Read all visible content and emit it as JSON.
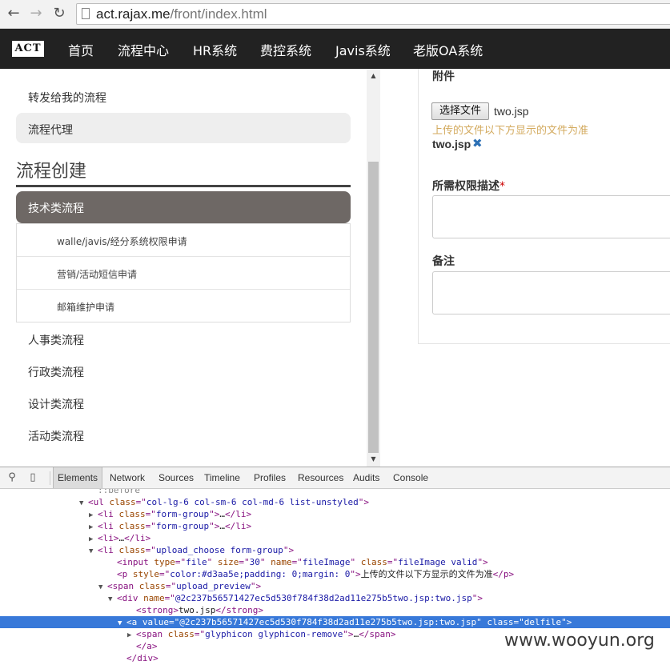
{
  "browser": {
    "back_icon": "back-arrow-icon",
    "forward_icon": "forward-arrow-icon",
    "reload_icon": "reload-icon",
    "url_host": "act.rajax.me",
    "url_path": "/front/index.html"
  },
  "app_nav": {
    "logo": "ACT",
    "items": [
      "首页",
      "流程中心",
      "HR系统",
      "费控系统",
      "Javis系统",
      "老版OA系统"
    ]
  },
  "sidebar": {
    "links_top": [
      "转发给我的流程",
      "流程代理"
    ],
    "section_title": "流程创建",
    "active_item": "技术类流程",
    "sub_items": [
      "walle/javis/经分系统权限申请",
      "营销/活动短信申请",
      "邮箱维护申请"
    ],
    "links_bottom": [
      "人事类流程",
      "行政类流程",
      "设计类流程",
      "活动类流程"
    ]
  },
  "form": {
    "attachment_label": "附件",
    "file_button": "选择文件",
    "file_name": "two.jsp",
    "upload_hint": "上传的文件以下方显示的文件为准",
    "preview_name": "two.jsp",
    "remove_icon": "remove-icon",
    "permission_label": "所需权限描述",
    "required_mark": "*",
    "remark_label": "备注",
    "hint_color": "#d3aa5e"
  },
  "devtools": {
    "search_icon": "search-icon",
    "device_icon": "mobile-device-icon",
    "tabs": [
      "Elements",
      "Network",
      "Sources",
      "Timeline",
      "Profiles",
      "Resources",
      "Audits",
      "Console"
    ],
    "active_tab": "Elements",
    "lines": [
      {
        "tri": "",
        "parts": [
          [
            "pseudo",
            "::before"
          ]
        ]
      },
      {
        "tri": "▼",
        "parts": [
          [
            "tg",
            "<ul "
          ],
          [
            "at",
            "class"
          ],
          [
            "tg",
            "=\""
          ],
          [
            "av",
            "col-lg-6 col-sm-6 col-md-6 list-unstyled"
          ],
          [
            "tg",
            "\">"
          ]
        ]
      },
      {
        "tri": "▶",
        "parts": [
          [
            "tg",
            "<li "
          ],
          [
            "at",
            "class"
          ],
          [
            "tg",
            "=\""
          ],
          [
            "av",
            "form-group"
          ],
          [
            "tg",
            "\">"
          ],
          [
            "tx",
            "…"
          ],
          [
            "tg",
            "</li>"
          ]
        ]
      },
      {
        "tri": "▶",
        "parts": [
          [
            "tg",
            "<li "
          ],
          [
            "at",
            "class"
          ],
          [
            "tg",
            "=\""
          ],
          [
            "av",
            "form-group"
          ],
          [
            "tg",
            "\">"
          ],
          [
            "tx",
            "…"
          ],
          [
            "tg",
            "</li>"
          ]
        ]
      },
      {
        "tri": "▶",
        "parts": [
          [
            "tg",
            "<li>"
          ],
          [
            "tx",
            "…"
          ],
          [
            "tg",
            "</li>"
          ]
        ]
      },
      {
        "tri": "▼",
        "parts": [
          [
            "tg",
            "<li "
          ],
          [
            "at",
            "class"
          ],
          [
            "tg",
            "=\""
          ],
          [
            "av",
            "upload_choose form-group"
          ],
          [
            "tg",
            "\">"
          ]
        ]
      },
      {
        "tri": "",
        "parts": [
          [
            "tg",
            "<input "
          ],
          [
            "at",
            "type"
          ],
          [
            "tg",
            "=\""
          ],
          [
            "av",
            "file"
          ],
          [
            "tg",
            "\" "
          ],
          [
            "at",
            "size"
          ],
          [
            "tg",
            "=\""
          ],
          [
            "av",
            "30"
          ],
          [
            "tg",
            "\" "
          ],
          [
            "at",
            "name"
          ],
          [
            "tg",
            "=\""
          ],
          [
            "av",
            "fileImage"
          ],
          [
            "tg",
            "\" "
          ],
          [
            "at",
            "class"
          ],
          [
            "tg",
            "=\""
          ],
          [
            "av",
            "fileImage valid"
          ],
          [
            "tg",
            "\">"
          ]
        ]
      },
      {
        "tri": "",
        "parts": [
          [
            "tg",
            "<p "
          ],
          [
            "at",
            "style"
          ],
          [
            "tg",
            "=\""
          ],
          [
            "av",
            "color:#d3aa5e;padding: 0;margin: 0"
          ],
          [
            "tg",
            "\">"
          ],
          [
            "tx",
            "上传的文件以下方显示的文件为准"
          ],
          [
            "tg",
            "</p>"
          ]
        ]
      },
      {
        "tri": "▼",
        "parts": [
          [
            "tg",
            "<span "
          ],
          [
            "at",
            "class"
          ],
          [
            "tg",
            "=\""
          ],
          [
            "av",
            "upload_preview"
          ],
          [
            "tg",
            "\">"
          ]
        ]
      },
      {
        "tri": "▼",
        "parts": [
          [
            "tg",
            "<div "
          ],
          [
            "at",
            "name"
          ],
          [
            "tg",
            "=\""
          ],
          [
            "av",
            "@2c237b56571427ec5d530f784f38d2ad11e275b5two.jsp:two.jsp"
          ],
          [
            "tg",
            "\">"
          ]
        ]
      },
      {
        "tri": "",
        "parts": [
          [
            "tg",
            "<strong>"
          ],
          [
            "tx",
            "two.jsp"
          ],
          [
            "tg",
            "</strong>"
          ]
        ]
      },
      {
        "tri": "▼",
        "sel": true,
        "parts": [
          [
            "tg",
            "<a "
          ],
          [
            "at",
            "value"
          ],
          [
            "tg",
            "=\""
          ],
          [
            "av",
            "@2c237b56571427ec5d530f784f38d2ad11e275b5two.jsp:two.jsp"
          ],
          [
            "tg",
            "\" "
          ],
          [
            "at",
            "class"
          ],
          [
            "tg",
            "=\""
          ],
          [
            "av",
            "delfile"
          ],
          [
            "tg",
            "\">"
          ]
        ]
      },
      {
        "tri": "▶",
        "parts": [
          [
            "tg",
            "<span "
          ],
          [
            "at",
            "class"
          ],
          [
            "tg",
            "=\""
          ],
          [
            "av",
            "glyphicon glyphicon-remove"
          ],
          [
            "tg",
            "\">"
          ],
          [
            "tx",
            "…"
          ],
          [
            "tg",
            "</span>"
          ]
        ]
      },
      {
        "tri": "",
        "parts": [
          [
            "tg",
            "</a>"
          ]
        ]
      },
      {
        "tri": "",
        "parts": [
          [
            "tg",
            "</div>"
          ]
        ]
      }
    ]
  },
  "watermark": "www.wooyun.org"
}
